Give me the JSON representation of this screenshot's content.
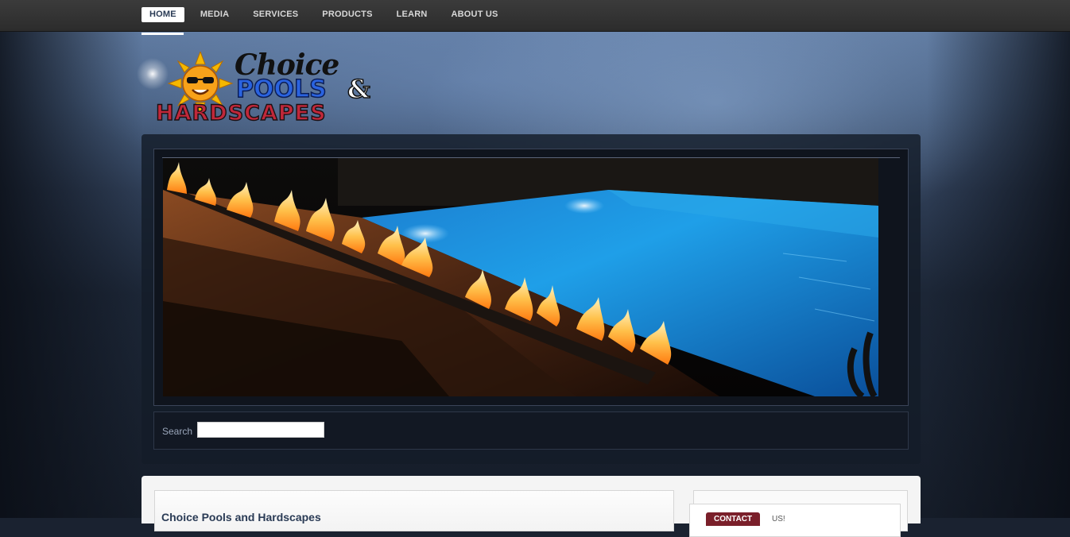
{
  "nav": {
    "items": [
      {
        "label": "HOME",
        "active": true
      },
      {
        "label": "MEDIA"
      },
      {
        "label": "SERVICES"
      },
      {
        "label": "PRODUCTS"
      },
      {
        "label": "LEARN"
      },
      {
        "label": "ABOUT US"
      }
    ]
  },
  "logo": {
    "line1": "Choice",
    "line2": "POOLS",
    "amp": "&",
    "line3": "HARDSCAPES"
  },
  "search": {
    "label": "Search",
    "value": ""
  },
  "main": {
    "title": "Choice Pools and Hardscapes"
  },
  "sidebar": {
    "tab_active": "CONTACT",
    "tab_other": "US!"
  },
  "colors": {
    "accent": "#2a3b55",
    "tab": "#7a1f2a",
    "nav_bg": "#333333"
  }
}
